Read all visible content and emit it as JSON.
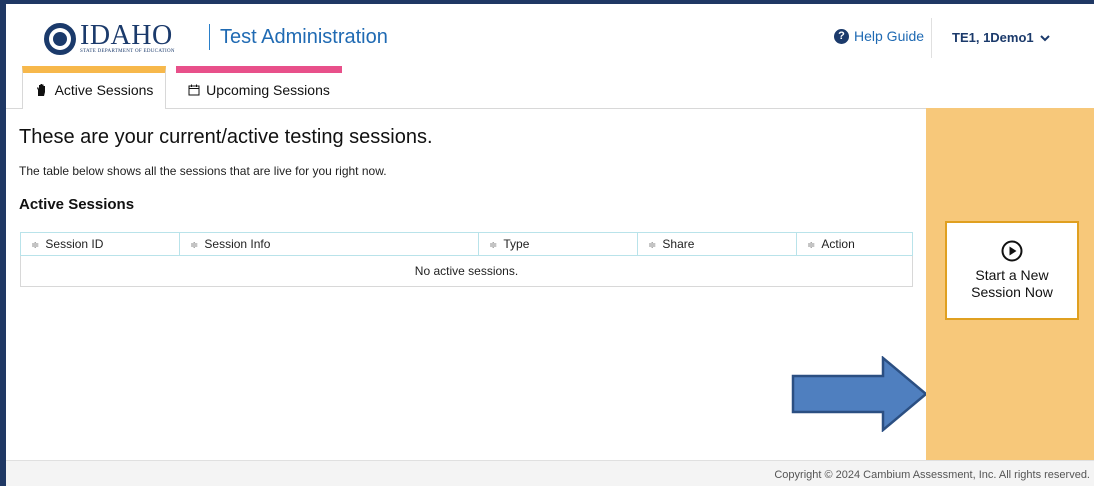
{
  "header": {
    "logo_word": "IDAHO",
    "logo_sub": "STATE DEPARTMENT OF EDUCATION",
    "app_title": "Test Administration",
    "help_label": "Help Guide",
    "user_name": "TE1, 1Demo1"
  },
  "tabs": [
    {
      "label": "Active Sessions",
      "icon": "hand-icon",
      "color": "#f7b84b",
      "active": true
    },
    {
      "label": "Upcoming Sessions",
      "icon": "calendar-icon",
      "color": "#e8508a",
      "active": false
    }
  ],
  "main": {
    "title": "These are your current/active testing sessions.",
    "description": "The table below shows all the sessions that are live for you right now.",
    "section_title": "Active Sessions",
    "table": {
      "columns": [
        "Session ID",
        "Session Info",
        "Type",
        "Share",
        "Action"
      ],
      "empty_message": "No active sessions."
    }
  },
  "side": {
    "start_label_line1": "Start a New",
    "start_label_line2": "Session Now",
    "panel_color": "#f7c87a"
  },
  "footer": {
    "copyright": "Copyright © 2024 Cambium Assessment, Inc. All rights reserved."
  }
}
